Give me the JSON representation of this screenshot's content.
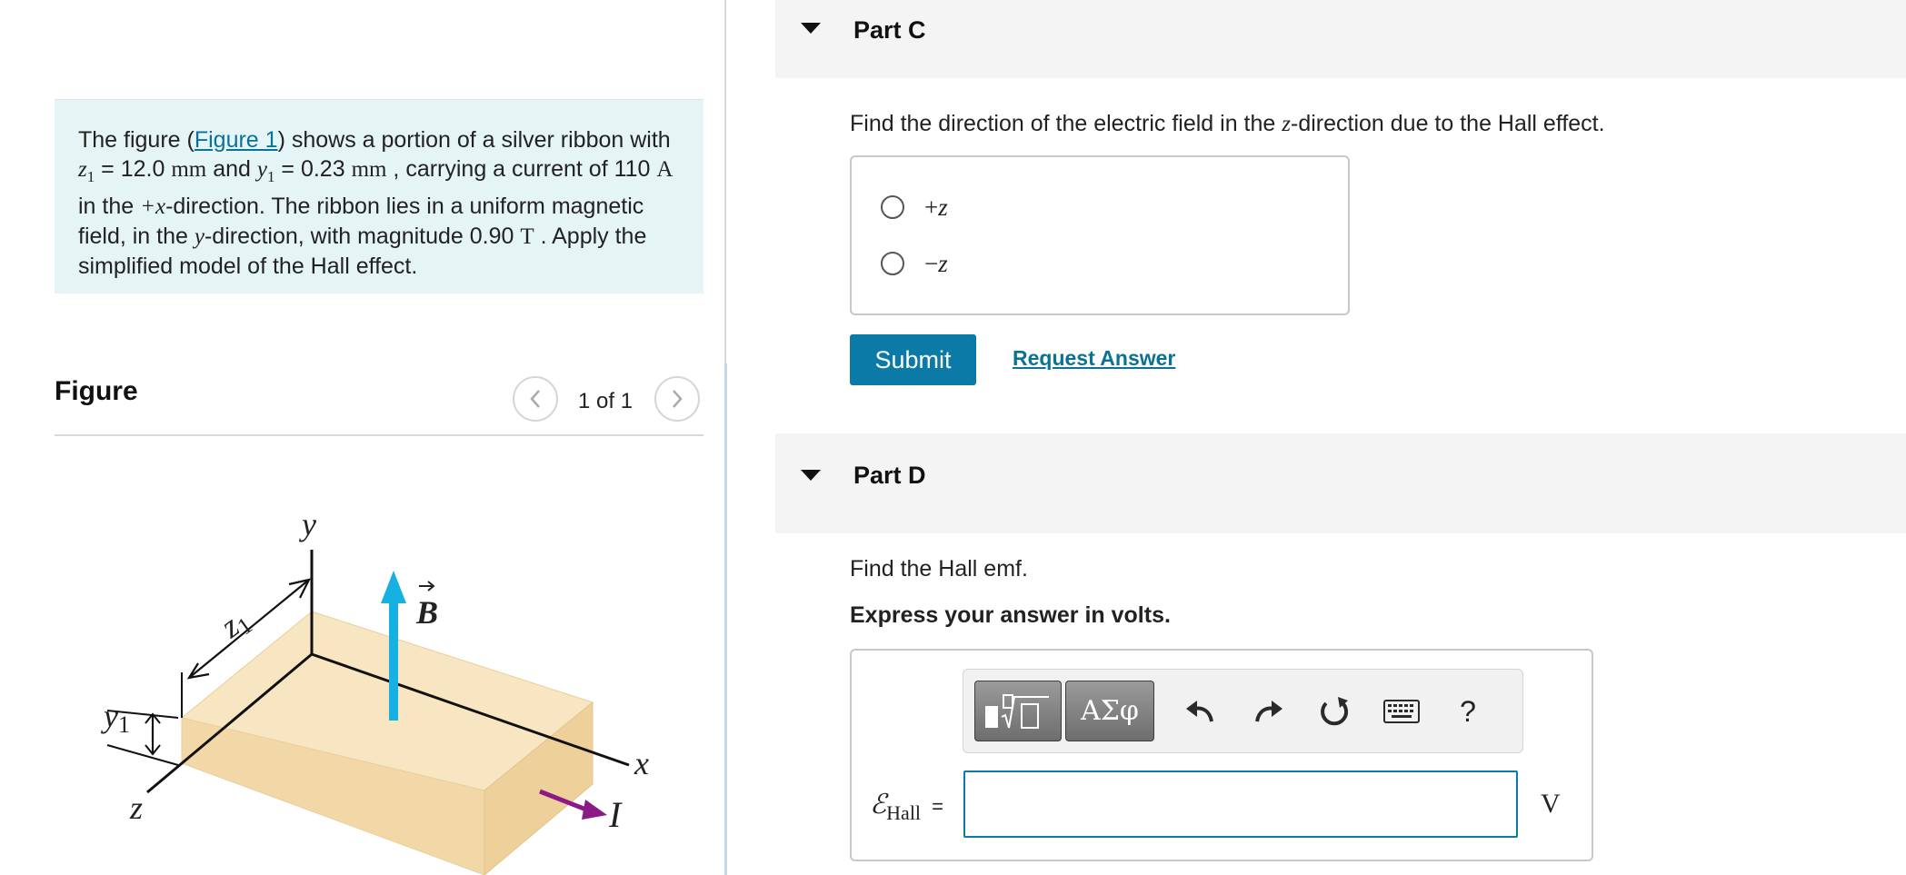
{
  "problem": {
    "intro": "The figure (",
    "figure_link": "Figure 1",
    "after_link": ") shows a portion of a silver ribbon with ",
    "z_var": "z",
    "z_sub": "1",
    "z_value": " = 12.0 ",
    "z_unit": "mm",
    "and_text": " and ",
    "y_var": "y",
    "y_sub": "1",
    "y_value": " = 0.23 ",
    "y_unit": "mm",
    "carrying_text": " , carrying a current of 110 ",
    "current_unit": "A",
    "in_the": " in the ",
    "plus_x": "+x",
    "direction_text": "-direction. The ribbon lies in a uniform magnetic field, in the ",
    "y_dir": "y",
    "magnitude_text": "-direction, with magnitude 0.90 ",
    "field_unit": "T",
    "closing_text": " . Apply the simplified model of the Hall effect."
  },
  "figure": {
    "title": "Figure",
    "counter": "1 of 1",
    "prev_icon": "chevron-left-icon",
    "next_icon": "chevron-right-icon",
    "labels": {
      "y_axis": "y",
      "x_axis": "x",
      "z_axis": "z",
      "z1_var": "z",
      "z1_sub": "1",
      "y1_var": "y",
      "y1_sub": "1",
      "b_field": "B",
      "current": "I"
    },
    "colors": {
      "ribbon_top": "#f8e6c2",
      "ribbon_front": "#f2d8a6",
      "ribbon_side": "#eed19a",
      "b_arrow": "#16b0e3",
      "current_arrow": "#8b1a86"
    }
  },
  "partC": {
    "title": "Part C",
    "question_pre": "Find the direction of the electric field in the ",
    "question_var": "z",
    "question_post": "-direction due to the Hall effect.",
    "options": [
      {
        "sign": "+",
        "var": "z"
      },
      {
        "sign": "−",
        "var": "z"
      }
    ],
    "submit_label": "Submit",
    "request_label": "Request Answer"
  },
  "partD": {
    "title": "Part D",
    "question": "Find the Hall emf.",
    "instruction": "Express your answer in volts.",
    "toolbar": {
      "symbols_label": "ΑΣφ",
      "help_label": "?",
      "icons": [
        "templates-icon",
        "undo-icon",
        "redo-icon",
        "reset-icon",
        "keyboard-icon",
        "help-icon"
      ]
    },
    "answer_label": "ℰ",
    "answer_sub": "Hall",
    "equals": "=",
    "answer_value": "",
    "unit": "V"
  }
}
